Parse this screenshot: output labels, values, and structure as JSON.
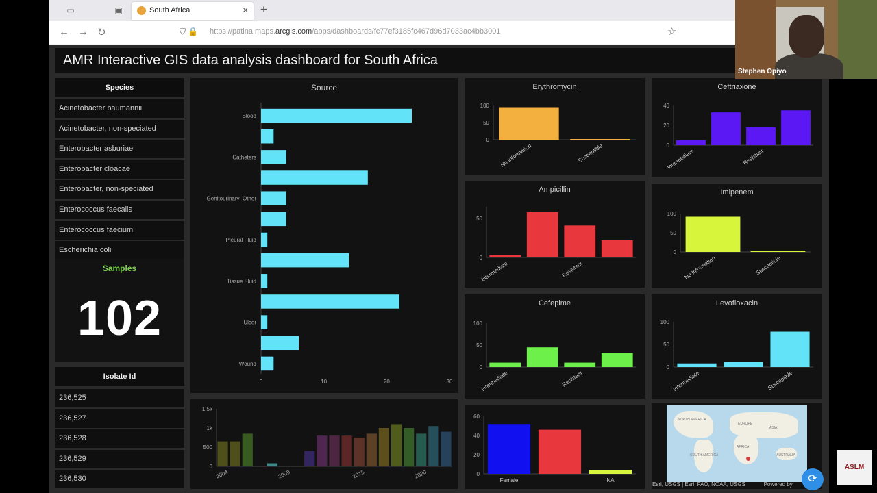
{
  "browser": {
    "tab_title": "South Africa",
    "url_host_prefix": "https://patina.maps.",
    "url_host": "arcgis.com",
    "url_path": "/apps/dashboards/fc77ef3185fc467d96d7033ac4bb3001"
  },
  "dashboard": {
    "title": "AMR Interactive GIS data analysis dashboard for South Africa",
    "species_header": "Species",
    "species": [
      "Acinetobacter baumannii",
      "Acinetobacter, non-speciated",
      "Enterobacter asburiae",
      "Enterobacter cloacae",
      "Enterobacter, non-speciated",
      "Enterococcus faecalis",
      "Enterococcus faecium",
      "Escherichia coli"
    ],
    "samples_label": "Samples",
    "samples_value": "102",
    "isolate_header": "Isolate Id",
    "isolates": [
      "236,525",
      "236,527",
      "236,528",
      "236,529",
      "236,530"
    ]
  },
  "webcam": {
    "name": "Stephen Opiyo"
  },
  "logo": {
    "text": "ASLM"
  },
  "map": {
    "credit": "Esri, USGS | Esri, FAO, NOAA, USGS",
    "powered": "Powered by",
    "labels": [
      "NORTH AMERICA",
      "EUROPE",
      "ASIA",
      "AFRICA",
      "SOUTH AMERICA",
      "AUSTRALIA"
    ]
  },
  "chart_data": [
    {
      "id": "source",
      "type": "bar",
      "orientation": "horizontal",
      "title": "Source",
      "categories": [
        "Blood",
        "",
        "Catheters",
        "",
        "Genitourinary: Other",
        "",
        "Pleural Fluid",
        "",
        "Tissue Fluid",
        "",
        "Ulcer",
        "",
        "Wound"
      ],
      "values": [
        24,
        2,
        4,
        17,
        4,
        4,
        1,
        14,
        1,
        22,
        1,
        6,
        2
      ],
      "xlim": [
        0,
        30
      ],
      "xticks": [
        "0",
        "10",
        "20",
        "30"
      ],
      "color": "#62e3f8"
    },
    {
      "id": "timeline",
      "type": "bar",
      "title": "",
      "x": [
        2004,
        2005,
        2006,
        2007,
        2008,
        2009,
        2010,
        2011,
        2012,
        2013,
        2014,
        2015,
        2016,
        2017,
        2018,
        2019,
        2020,
        2021
      ],
      "values": [
        650,
        650,
        850,
        0,
        80,
        0,
        0,
        400,
        800,
        800,
        800,
        750,
        850,
        1000,
        1100,
        1000,
        850,
        1050,
        900
      ],
      "ylim": [
        0,
        1500
      ],
      "yticks": [
        "0",
        "500",
        "1k",
        "1.5k"
      ],
      "xticks": [
        "2004",
        "2009",
        "2015",
        "2020"
      ]
    },
    {
      "id": "erythromycin",
      "type": "bar",
      "title": "Erythromycin",
      "categories": [
        "No Information",
        "Susceptible"
      ],
      "values": [
        95,
        2
      ],
      "ylim": [
        0,
        100
      ],
      "yticks": [
        "0",
        "50",
        "100"
      ],
      "color": "#f4b03e"
    },
    {
      "id": "ceftriaxone",
      "type": "bar",
      "title": "Ceftriaxone",
      "categories": [
        "Intermediate",
        "",
        "Resistant",
        ""
      ],
      "values": [
        5,
        33,
        18,
        35
      ],
      "ylim": [
        0,
        40
      ],
      "yticks": [
        "0",
        "20",
        "40"
      ],
      "color": "#5b17f4"
    },
    {
      "id": "ampicillin",
      "type": "bar",
      "title": "Ampicillin",
      "categories": [
        "Intermediate",
        "",
        "Resistant",
        ""
      ],
      "values": [
        3,
        58,
        41,
        22
      ],
      "ylim": [
        0,
        65
      ],
      "yticks": [
        "0",
        "50"
      ],
      "color": "#e8383d"
    },
    {
      "id": "imipenem",
      "type": "bar",
      "title": "Imipenem",
      "categories": [
        "No Information",
        "Susceptible"
      ],
      "values": [
        92,
        3
      ],
      "ylim": [
        0,
        100
      ],
      "yticks": [
        "0",
        "50",
        "100"
      ],
      "color": "#d7f53a"
    },
    {
      "id": "cefepime",
      "type": "bar",
      "title": "Cefepime",
      "categories": [
        "Intermediate",
        "",
        "Resistant",
        ""
      ],
      "values": [
        10,
        45,
        10,
        32
      ],
      "ylim": [
        0,
        100
      ],
      "yticks": [
        "0",
        "50",
        "100"
      ],
      "color": "#6df04a"
    },
    {
      "id": "levofloxacin",
      "type": "bar",
      "title": "Levofloxacin",
      "categories": [
        "Intermediate",
        "",
        "Susceptible"
      ],
      "values": [
        8,
        11,
        78
      ],
      "ylim": [
        0,
        100
      ],
      "yticks": [
        "0",
        "50",
        "100"
      ],
      "color": "#62e3f8"
    },
    {
      "id": "sex",
      "type": "bar",
      "title": "",
      "categories": [
        "Female",
        "",
        "NA"
      ],
      "values": [
        52,
        46,
        4
      ],
      "colors": [
        "#1010f0",
        "#e8383d",
        "#d7f53a"
      ],
      "ylim": [
        0,
        60
      ],
      "yticks": [
        "0",
        "20",
        "40",
        "60"
      ]
    }
  ]
}
